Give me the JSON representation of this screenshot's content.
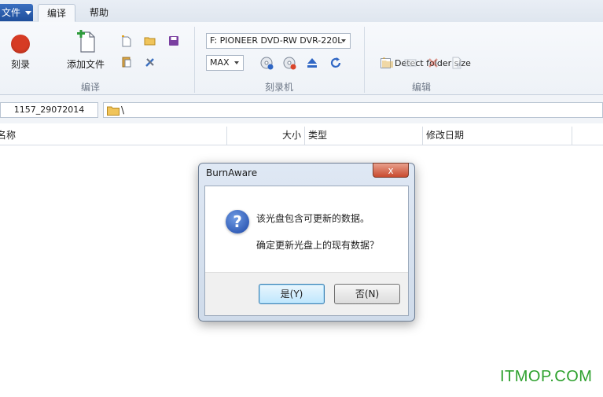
{
  "menu": {
    "file_label": "文件",
    "tabs": [
      {
        "label": "编译",
        "active": true
      },
      {
        "label": "帮助",
        "active": false
      }
    ]
  },
  "ribbon": {
    "compile_group": {
      "label": "编译",
      "burn_label": "刻录",
      "add_files_label": "添加文件"
    },
    "recorder_group": {
      "label": "刻录机",
      "drive": "F: PIONEER DVD-RW  DVR-220L",
      "speed": "MAX"
    },
    "edit_group": {
      "label": "编辑",
      "detect_folder_size": "Detect folder size",
      "detect_checked": false
    }
  },
  "pathbar": {
    "disc_label": "1157_29072014",
    "path": "\\"
  },
  "columns": [
    "名称",
    "大小",
    "类型",
    "修改日期"
  ],
  "dialog": {
    "title": "BurnAware",
    "close_symbol": "x",
    "message_line1": "该光盘包含可更新的数据。",
    "message_line2": "确定更新光盘上的现有数据？",
    "yes_label": "是(Y)",
    "no_label": "否(N)"
  },
  "watermark": "ITMOP.COM",
  "colors": {
    "accent": "#1f4f9c",
    "record_red": "#d63b24",
    "watermark_green": "#2ea12e"
  }
}
